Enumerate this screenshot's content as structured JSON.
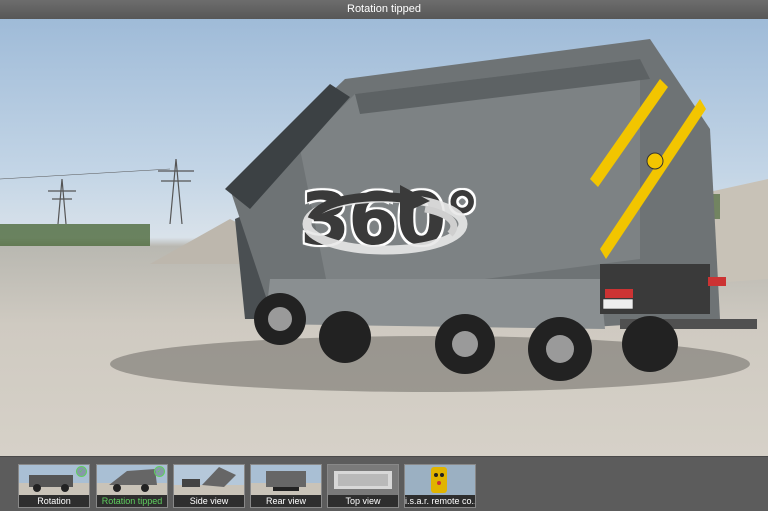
{
  "window": {
    "title": "Rotation tipped"
  },
  "viewer": {
    "overlay_text": "360°",
    "overlay_icon": "rotate-360-icon"
  },
  "thumbnails": [
    {
      "label": "Rotation",
      "checked": true,
      "active": false
    },
    {
      "label": "Rotation tipped",
      "checked": true,
      "active": true
    },
    {
      "label": "Side view",
      "checked": false,
      "active": false
    },
    {
      "label": "Rear view",
      "checked": false,
      "active": false
    },
    {
      "label": "Top view",
      "checked": false,
      "active": false
    },
    {
      "label": "i.s.a.r. remote co...",
      "checked": false,
      "active": false
    }
  ],
  "colors": {
    "accent_active": "#5fcf5f",
    "tipper_body": "#6e7375",
    "tipper_stripe": "#f2c500"
  }
}
